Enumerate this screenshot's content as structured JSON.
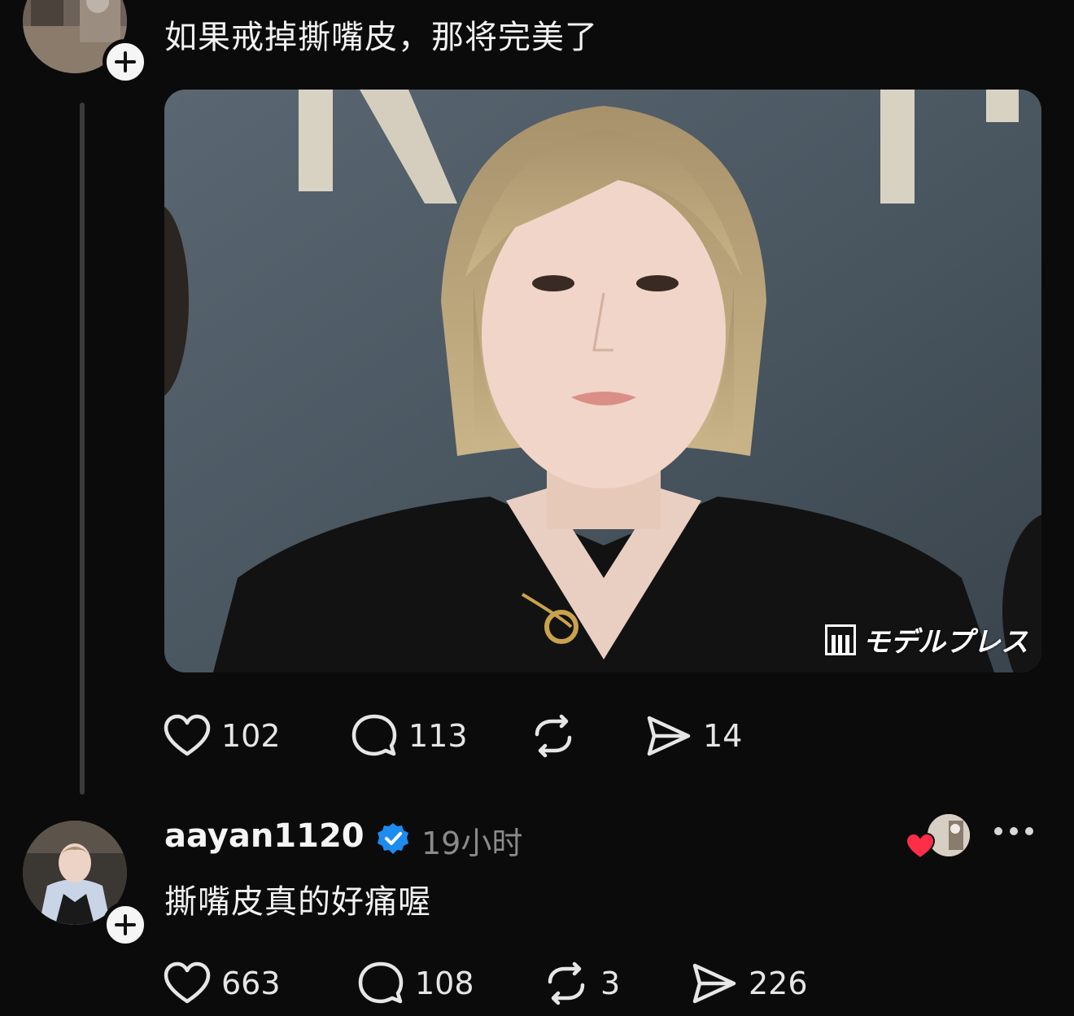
{
  "post1": {
    "text": "如果戒掉撕嘴皮，那将完美了",
    "media": {
      "watermark": "モデルプレス"
    },
    "actions": {
      "likes": "102",
      "replies": "113",
      "shares": "14"
    }
  },
  "post2": {
    "username": "aayan1120",
    "time": "19小时",
    "text": "撕嘴皮真的好痛喔",
    "actions": {
      "likes": "663",
      "replies": "108",
      "reposts": "3",
      "shares": "226"
    }
  },
  "colors": {
    "background": "#0b0b0b",
    "verified": "#1d8cf0",
    "heart": "#ff2d48",
    "muted": "#8a8a8a"
  }
}
